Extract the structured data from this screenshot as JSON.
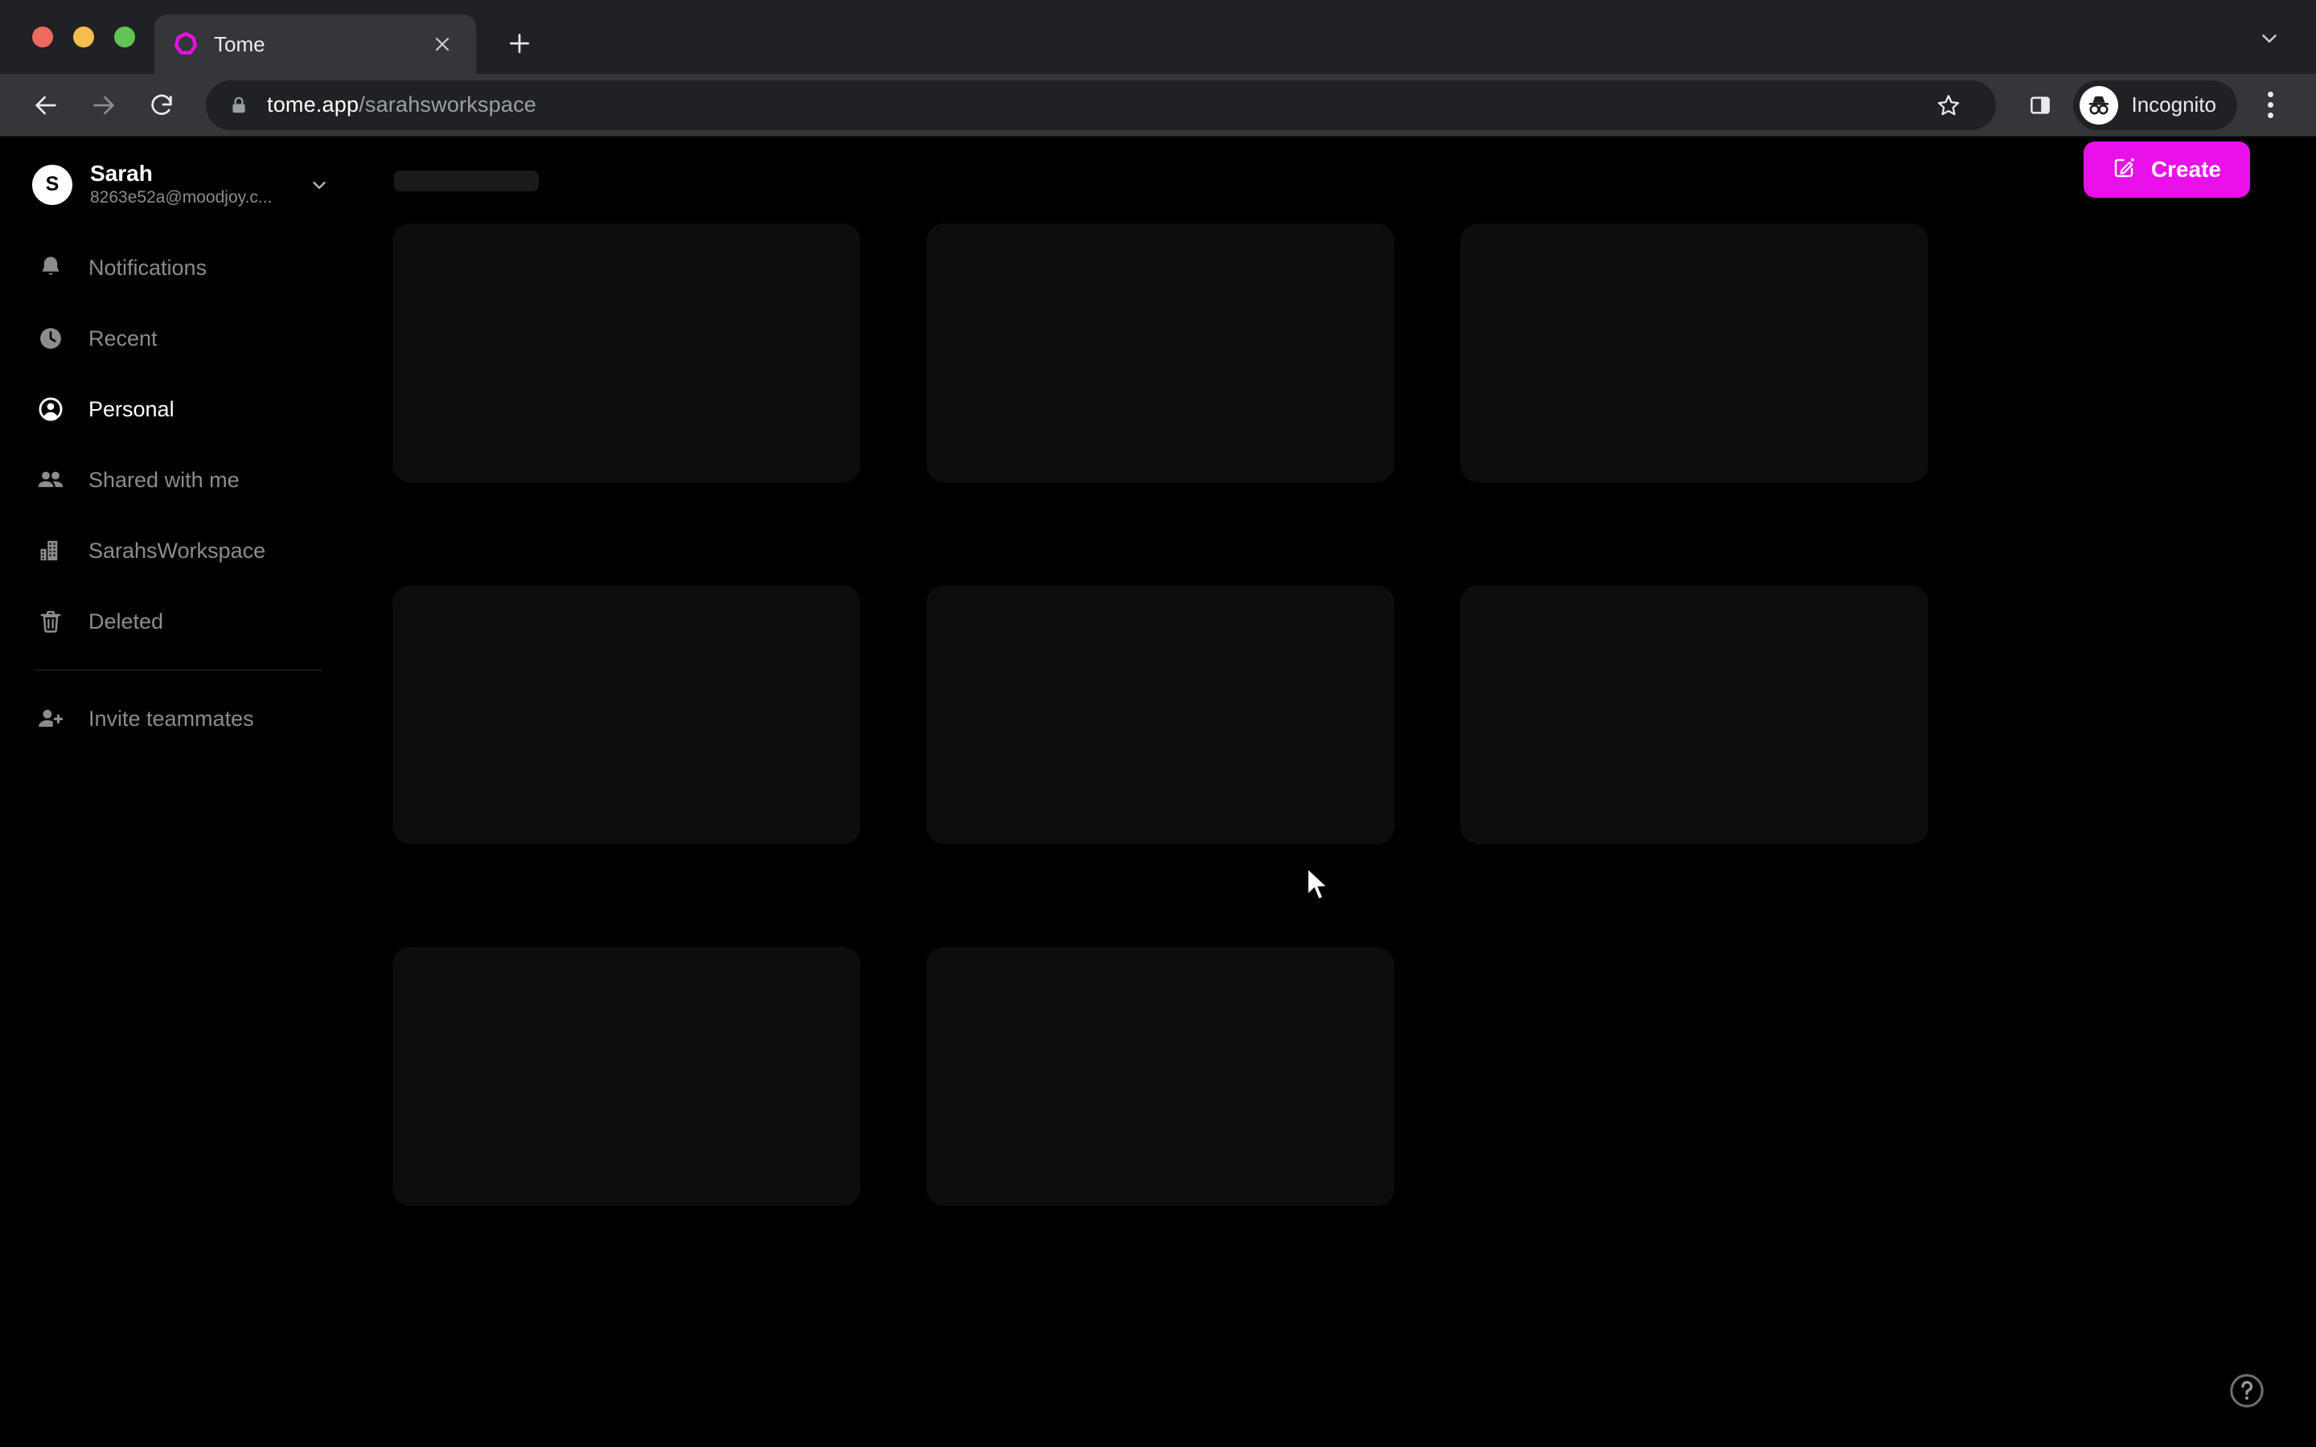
{
  "browser": {
    "tab": {
      "title": "Tome",
      "favicon": "tome-logo-icon",
      "close": "close-icon"
    },
    "new_tab_label": "+",
    "toolbar": {
      "back": "back-arrow-icon",
      "forward": "forward-arrow-icon",
      "reload": "reload-icon",
      "lock": "lock-icon",
      "url_host": "tome.app",
      "url_path": "/sarahsworkspace",
      "bookmark": "star-icon",
      "side_panel": "side-panel-icon",
      "profile_label": "Incognito",
      "menu": "kebab-menu-icon"
    }
  },
  "sidebar": {
    "profile": {
      "avatar_initial": "S",
      "name": "Sarah",
      "email": "8263e52a@moodjoy.c..."
    },
    "items": [
      {
        "label": "Notifications",
        "icon": "bell-icon",
        "active": false
      },
      {
        "label": "Recent",
        "icon": "clock-icon",
        "active": false
      },
      {
        "label": "Personal",
        "icon": "person-circle-icon",
        "active": true
      },
      {
        "label": "Shared with me",
        "icon": "people-icon",
        "active": false
      },
      {
        "label": "SarahsWorkspace",
        "icon": "building-icon",
        "active": false
      },
      {
        "label": "Deleted",
        "icon": "trash-icon",
        "active": false
      }
    ],
    "footer_items": [
      {
        "label": "Invite teammates",
        "icon": "person-add-icon"
      }
    ]
  },
  "main": {
    "create_button": {
      "label": "Create",
      "icon": "edit-square-icon",
      "color": "#E910E9"
    },
    "loading": true,
    "skeleton_card_count": 8,
    "help_button": {
      "icon": "help-circle-icon"
    }
  },
  "colors": {
    "accent": "#E910E9",
    "app_bg": "#000000",
    "card_bg": "#0D0D0D",
    "chrome_bg": "#35363A",
    "tabstrip_bg": "#202124",
    "text_muted": "#8C8C8C",
    "text_primary": "#FFFFFF"
  }
}
